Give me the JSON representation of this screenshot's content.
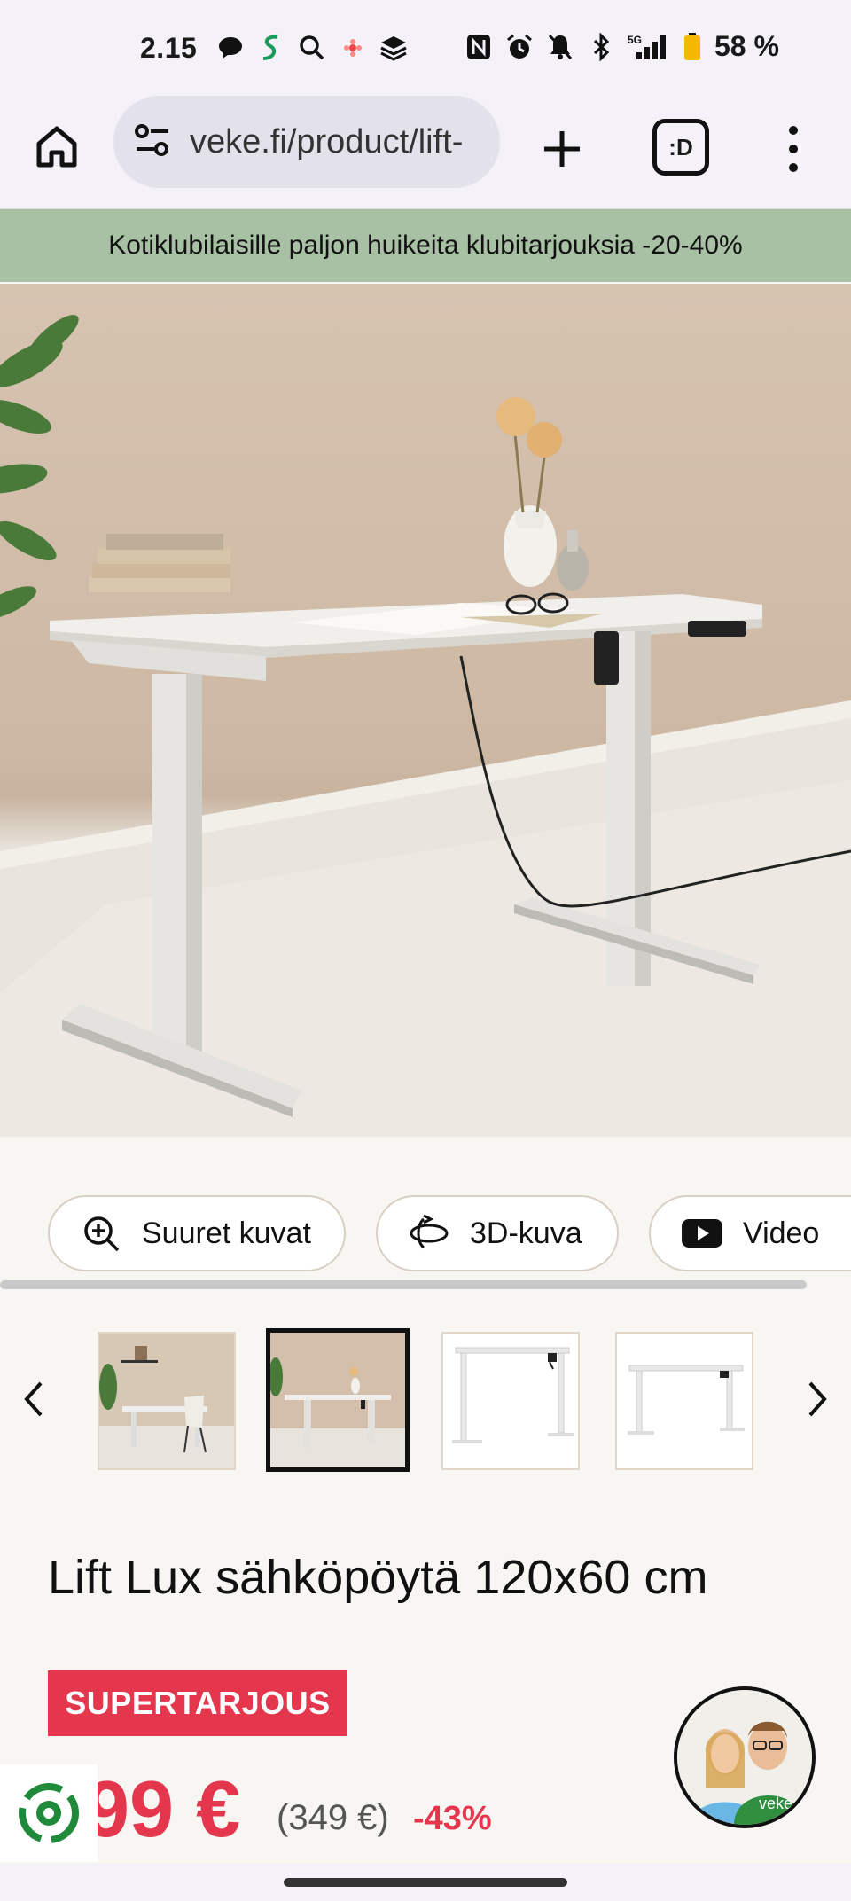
{
  "status_bar": {
    "time": "2.15",
    "battery": "58 %",
    "network": "5G",
    "icons_left": [
      "chat-icon",
      "s-app-icon",
      "search-icon",
      "flower-app-icon",
      "layers-icon"
    ],
    "icons_right": [
      "nfc-icon",
      "alarm-icon",
      "mute-icon",
      "bluetooth-icon",
      "signal-icon",
      "battery-icon"
    ]
  },
  "browser": {
    "url": "veke.fi/product/lift-",
    "tabs_label": ":D"
  },
  "promo": {
    "text": "Kotiklubilaisille paljon huikeita klubitarjouksia -20-40%"
  },
  "media_buttons": [
    {
      "label": "Suuret kuvat",
      "icon": "zoom-in-icon"
    },
    {
      "label": "3D-kuva",
      "icon": "rotate-3d-icon"
    },
    {
      "label": "Video",
      "icon": "youtube-icon"
    }
  ],
  "thumbnails": [
    {
      "name": "desk-with-chair"
    },
    {
      "name": "desk-room"
    },
    {
      "name": "desk-white-front"
    },
    {
      "name": "desk-white-side"
    }
  ],
  "product": {
    "title": "Lift Lux sähköpöytä 120x60 cm",
    "badge": "SUPERTARJOUS",
    "price_current": "99 €",
    "price_old": "(349 €)",
    "discount": "-43%"
  },
  "chat": {
    "brand_text": "veke"
  },
  "colors": {
    "accent_red": "#e4374e",
    "promo_green": "#a8c0a4",
    "background": "#f8f6f3"
  }
}
